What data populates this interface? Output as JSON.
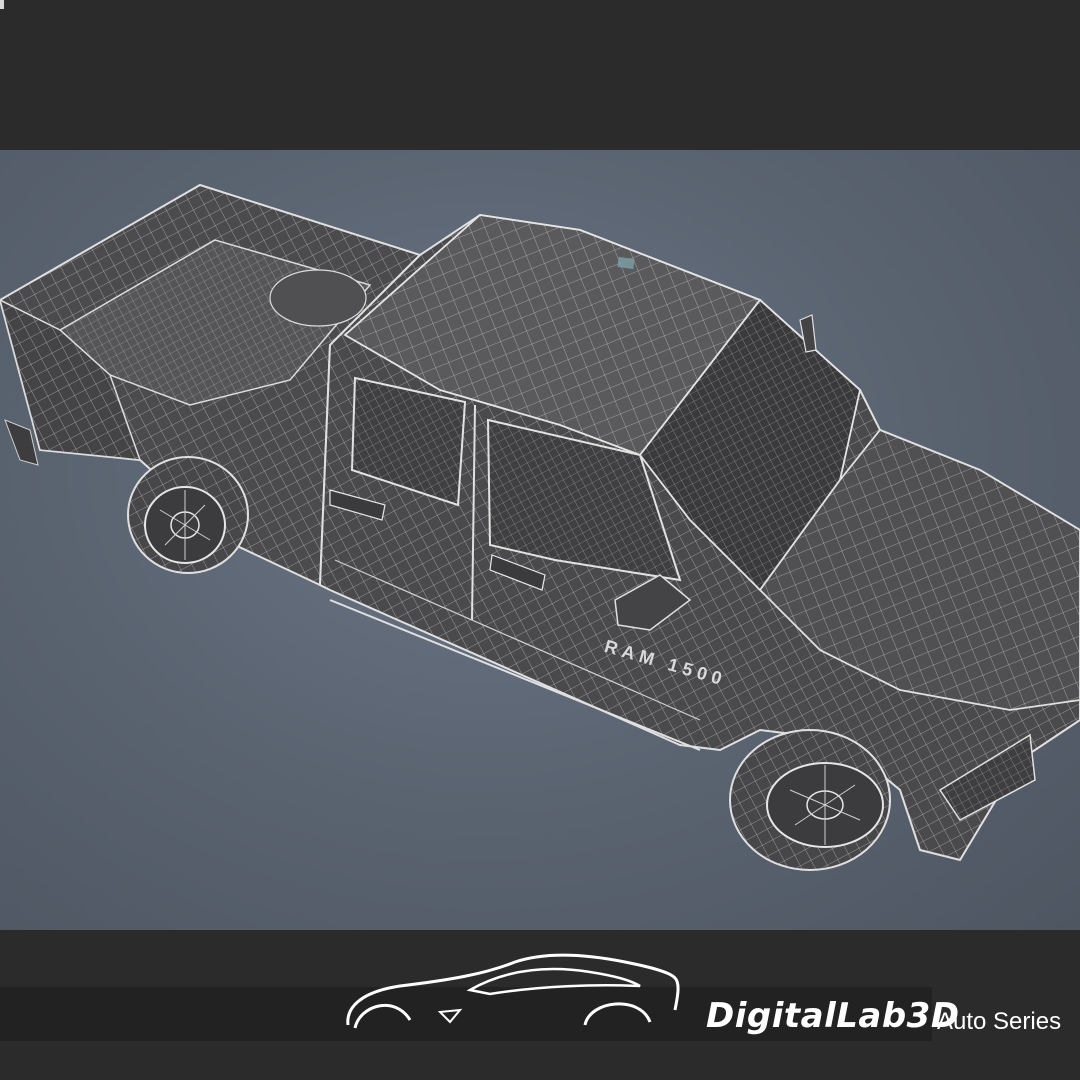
{
  "colors": {
    "frame": "#2b2b2b",
    "viewport_background": "#5b6470",
    "mesh_body": "#4a4a4c",
    "wire": "#d9d9d9",
    "logo_text": "#ffffff"
  },
  "viewport": {
    "subject": "pickup truck wireframe model",
    "badge_text": "RAM 1500"
  },
  "branding": {
    "logo_icon": "sports-car-silhouette-icon",
    "brand_name": "DigitalLab3D",
    "series_label": "Auto Series"
  }
}
